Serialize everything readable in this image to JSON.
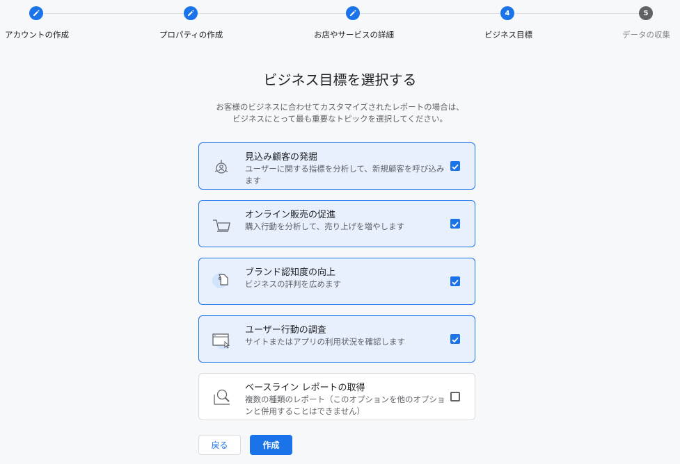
{
  "stepper": {
    "steps": [
      {
        "label": "アカウントの作成",
        "state": "done",
        "icon": "pencil-icon"
      },
      {
        "label": "プロパティの作成",
        "state": "done",
        "icon": "pencil-icon"
      },
      {
        "label": "お店やサービスの詳細",
        "state": "done",
        "icon": "pencil-icon"
      },
      {
        "label": "ビジネス目標",
        "state": "current",
        "number": "4"
      },
      {
        "label": "データの収集",
        "state": "future",
        "number": "5"
      }
    ]
  },
  "page": {
    "title": "ビジネス目標を選択する",
    "subtitle_line1": "お客様のビジネスに合わせてカスタマイズされたレポートの場合は、",
    "subtitle_line2": "ビジネスにとって最も重要なトピックを選択してください。"
  },
  "options": [
    {
      "title": "見込み顧客の発掘",
      "desc": "ユーザーに関する指標を分析して、新規顧客を呼び込みます",
      "checked": true,
      "icon": "target-person-icon"
    },
    {
      "title": "オンライン販売の促進",
      "desc": "購入行動を分析して、売り上げを増やします",
      "checked": true,
      "icon": "shopping-cart-icon"
    },
    {
      "title": "ブランド認知度の向上",
      "desc": "ビジネスの評判を広めます",
      "checked": true,
      "icon": "price-tag-icon"
    },
    {
      "title": "ユーザー行動の調査",
      "desc": "サイトまたはアプリの利用状況を確認します",
      "checked": true,
      "icon": "browser-cursor-icon"
    },
    {
      "title": "ベースライン レポートの取得",
      "desc": "複数の種類のレポート（このオプションを他のオプションと併用することはできません）",
      "checked": false,
      "icon": "magnifier-icon"
    }
  ],
  "actions": {
    "back_label": "戻る",
    "create_label": "作成"
  },
  "colors": {
    "accent": "#1a73e8",
    "selected_bg": "#e8f0fe",
    "future_step": "#5f6368"
  }
}
